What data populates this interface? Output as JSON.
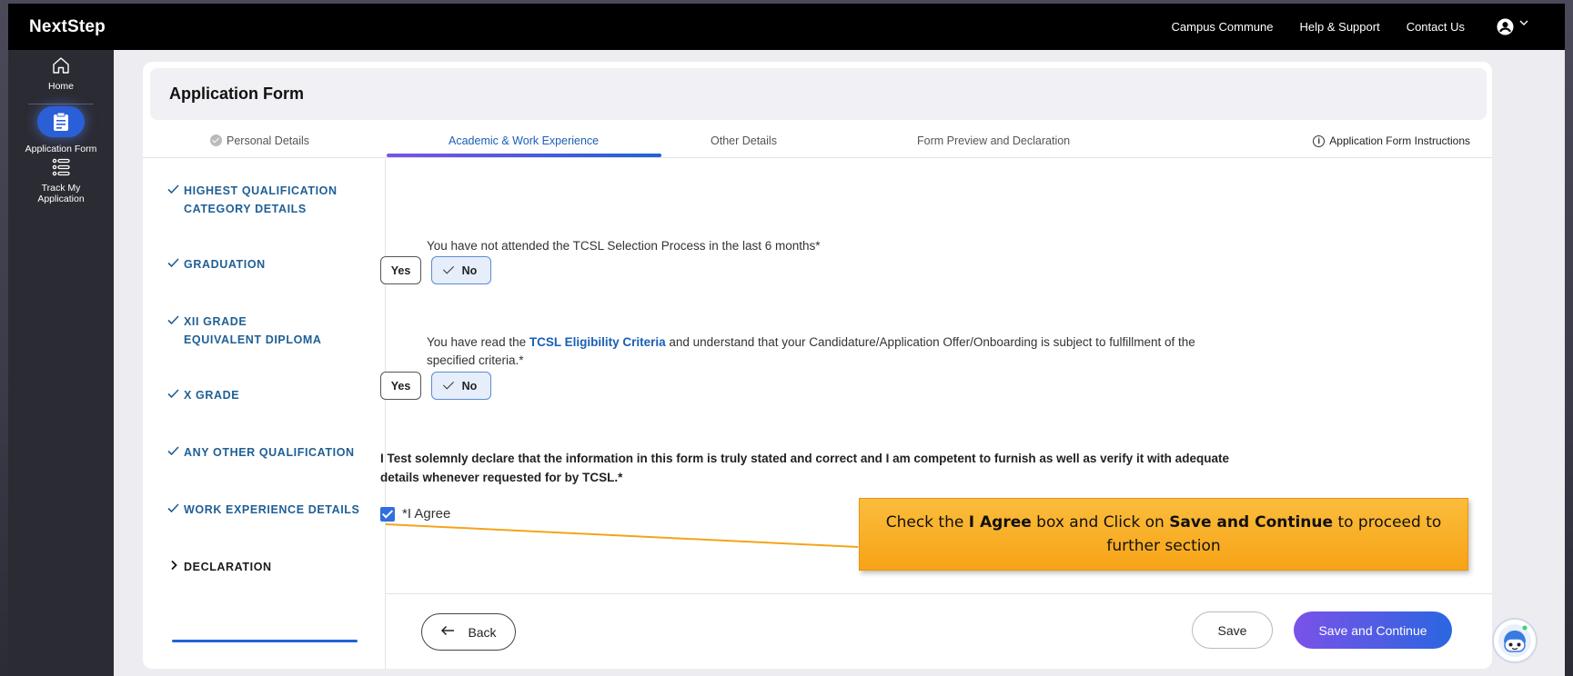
{
  "app": {
    "brand": "NextStep"
  },
  "topnav": {
    "campus_commune": "Campus Commune",
    "help_support": "Help & Support",
    "contact_us": "Contact Us"
  },
  "sidebar": {
    "items": [
      {
        "label": "Home",
        "icon": "home-icon"
      },
      {
        "label": "Application Form",
        "icon": "clipboard-icon"
      },
      {
        "label": "Track My Application",
        "icon": "list-icon"
      }
    ]
  },
  "page": {
    "title": "Application Form"
  },
  "tabs": [
    {
      "label": "Personal Details"
    },
    {
      "label": "Academic & Work Experience"
    },
    {
      "label": "Other Details"
    },
    {
      "label": "Form Preview and Declaration"
    }
  ],
  "instructions_link": "Application Form Instructions",
  "sections": [
    {
      "line1": "HIGHEST QUALIFICATION",
      "line2": "CATEGORY DETAILS"
    },
    {
      "line1": "GRADUATION"
    },
    {
      "line1": "XII GRADE",
      "line2": "EQUIVALENT DIPLOMA"
    },
    {
      "line1": "X GRADE"
    },
    {
      "line1": "ANY OTHER QUALIFICATION"
    },
    {
      "line1": "WORK EXPERIENCE DETAILS"
    },
    {
      "line1": "DECLARATION"
    }
  ],
  "questions": {
    "q1": {
      "text": "You have not attended the TCSL Selection Process in the last 6 months*",
      "yes": "Yes",
      "no": "No",
      "selected": "No"
    },
    "q2": {
      "prefix": "You have read the ",
      "link": "TCSL Eligibility Criteria",
      "suffix": " and understand that your Candidature/Application Offer/Onboarding is subject to fulfillment of the specified criteria.*",
      "yes": "Yes",
      "no": "No",
      "selected": "No"
    }
  },
  "declaration": {
    "text": "I Test solemnly declare that the information in this form is truly stated and correct and I am competent to furnish as well as verify it with adequate details whenever requested for by TCSL.*",
    "agree_label": "*I Agree",
    "agree_checked": true
  },
  "footer": {
    "back": "Back",
    "save": "Save",
    "save_continue": "Save and Continue"
  },
  "callout": {
    "part1": "Check the ",
    "bold1": "I Agree",
    "part2": " box and Click on ",
    "bold2": "Save and Continue",
    "part3": " to proceed to further section"
  },
  "colors": {
    "accent": "#1e63d8",
    "callout": "#f7a316",
    "topbar": "#000000",
    "sidebar": "#2b2b33"
  }
}
